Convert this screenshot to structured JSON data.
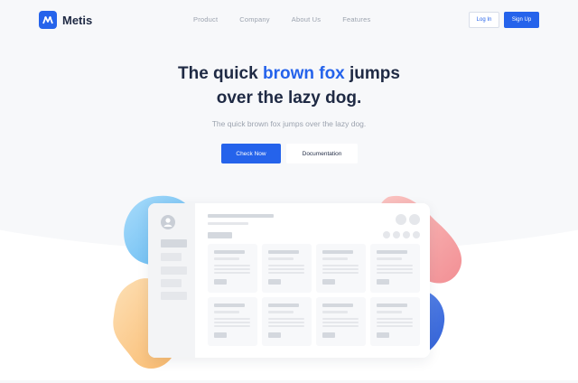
{
  "brand": {
    "name": "Metis",
    "color": "#2563eb"
  },
  "nav": {
    "items": [
      {
        "label": "Product"
      },
      {
        "label": "Company"
      },
      {
        "label": "About Us"
      },
      {
        "label": "Features"
      }
    ]
  },
  "header": {
    "login_label": "Log In",
    "signup_label": "Sign Up"
  },
  "hero": {
    "title_part1": "The quick ",
    "title_accent": "brown fox",
    "title_part2": " jumps",
    "title_line2": "over the lazy dog.",
    "subtitle": "The quick brown fox jumps over the lazy dog.",
    "primary_label": "Check Now",
    "secondary_label": "Documentation"
  },
  "colors": {
    "accent": "#2563eb",
    "text_dark": "#1f2a44",
    "text_muted": "#9ca3af",
    "blob_blue": "#7cc8f5",
    "blob_orange": "#fbc98c",
    "blob_red": "#f7a9aa",
    "blob_navy": "#3b6fe0"
  }
}
